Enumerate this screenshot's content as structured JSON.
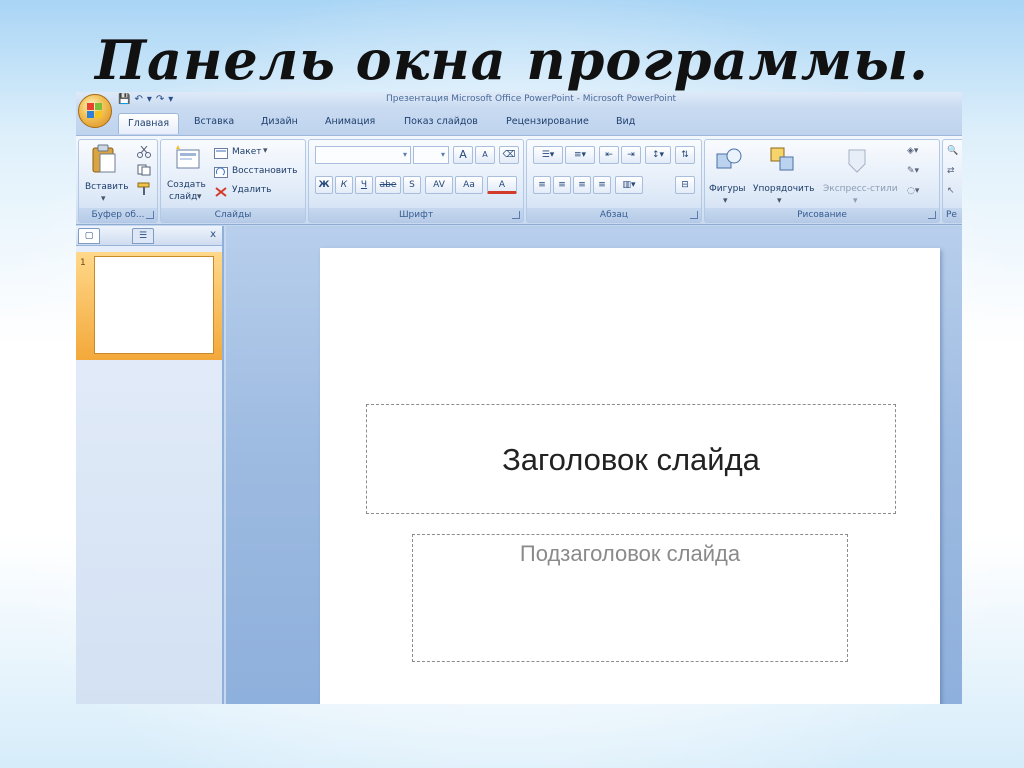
{
  "heading": "Панель окна программы.",
  "window": {
    "title": "Презентация Microsoft Office PowerPoint - Microsoft PowerPoint",
    "qat": [
      "💾",
      "↶",
      "▾",
      "↷",
      "▾"
    ]
  },
  "tabs": [
    "Главная",
    "Вставка",
    "Дизайн",
    "Анимация",
    "Показ слайдов",
    "Рецензирование",
    "Вид"
  ],
  "ribbon": {
    "clipboard": {
      "label": "Буфер об...",
      "paste": "Вставить"
    },
    "slides": {
      "label": "Слайды",
      "create_line1": "Создать",
      "create_line2": "слайд",
      "layout": "Макет",
      "reset": "Восстановить",
      "delete": "Удалить"
    },
    "font": {
      "label": "Шрифт",
      "bold": "Ж",
      "italic": "К",
      "underline": "Ч",
      "strike": "abe",
      "spacing": "AV",
      "case": "Aa",
      "color": "A",
      "grow": "A",
      "shrink": "A"
    },
    "paragraph": {
      "label": "Абзац"
    },
    "drawing": {
      "label": "Рисование",
      "shapes": "Фигуры",
      "arrange": "Упорядочить",
      "styles": "Экспресс-стили"
    },
    "editing": {
      "label": "Ре"
    }
  },
  "slide": {
    "title_placeholder": "Заголовок слайда",
    "subtitle_placeholder": "Подзаголовок слайда"
  },
  "pane": {
    "slide_number": "1",
    "close": "x"
  }
}
